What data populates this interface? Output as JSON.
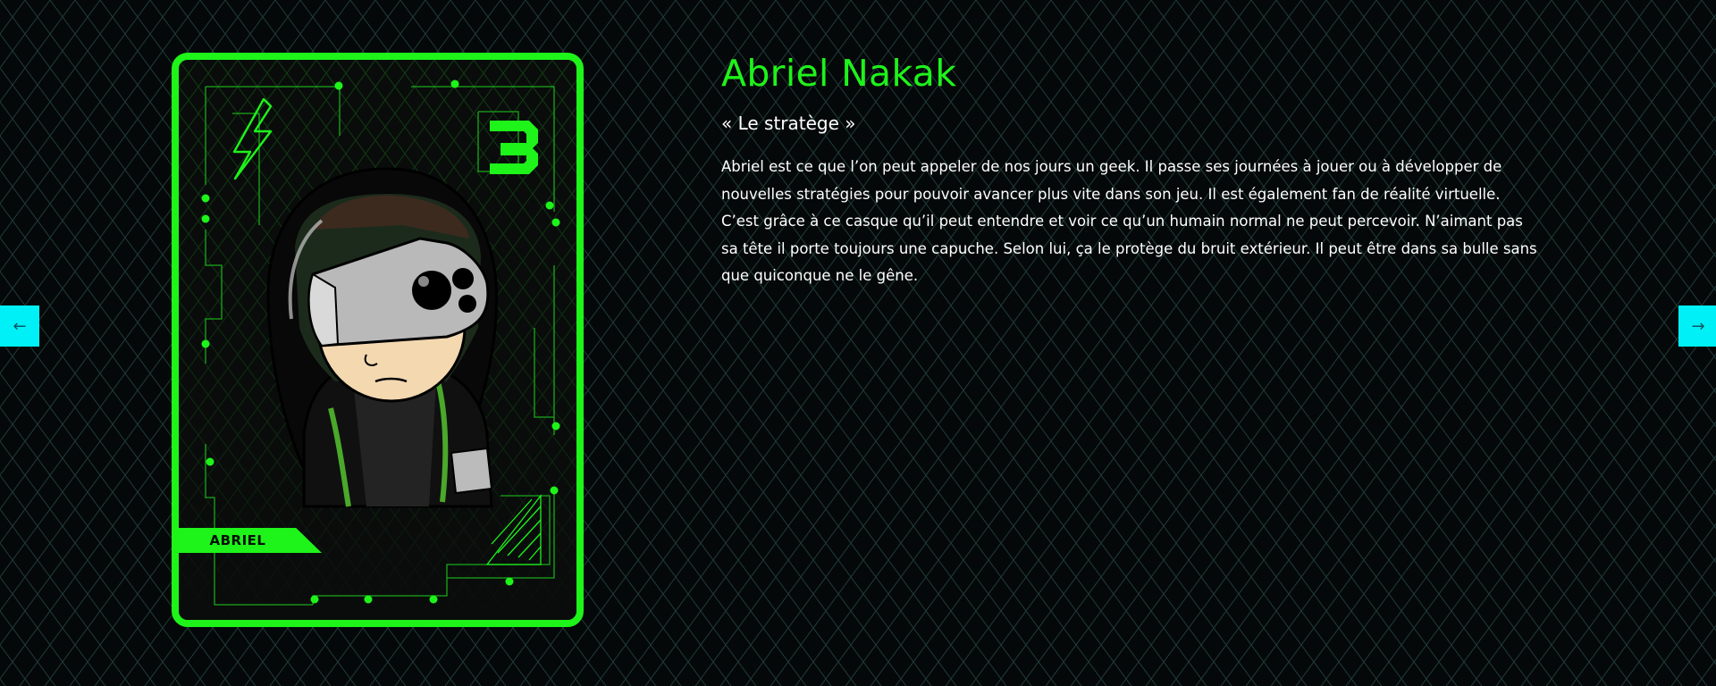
{
  "character": {
    "name": "Abriel Nakak",
    "nickname": "« Le stratège »",
    "description": "Abriel est ce que l’on peut appeler de nos jours un geek. Il passe ses journées à jouer ou à développer de nouvelles stratégies pour pouvoir avancer plus vite dans son jeu. Il est également fan de réalité virtuelle. C’est grâce à ce casque qu’il peut entendre et voir ce qu’un humain normal ne peut percevoir. N’aimant pas sa tête il porte toujours une capuche. Selon lui, ça le protège du bruit extérieur. Il peut être dans sa bulle sans que quiconque ne le gêne.",
    "card_tag": "ABRIEL"
  },
  "nav": {
    "prev_icon": "←",
    "next_icon": "→"
  },
  "colors": {
    "accent": "#1ef31a",
    "nav": "#00f0f8",
    "background": "#050808"
  },
  "icons": {
    "card_icon_left": "lightning-icon",
    "card_icon_right": "three-icon"
  }
}
